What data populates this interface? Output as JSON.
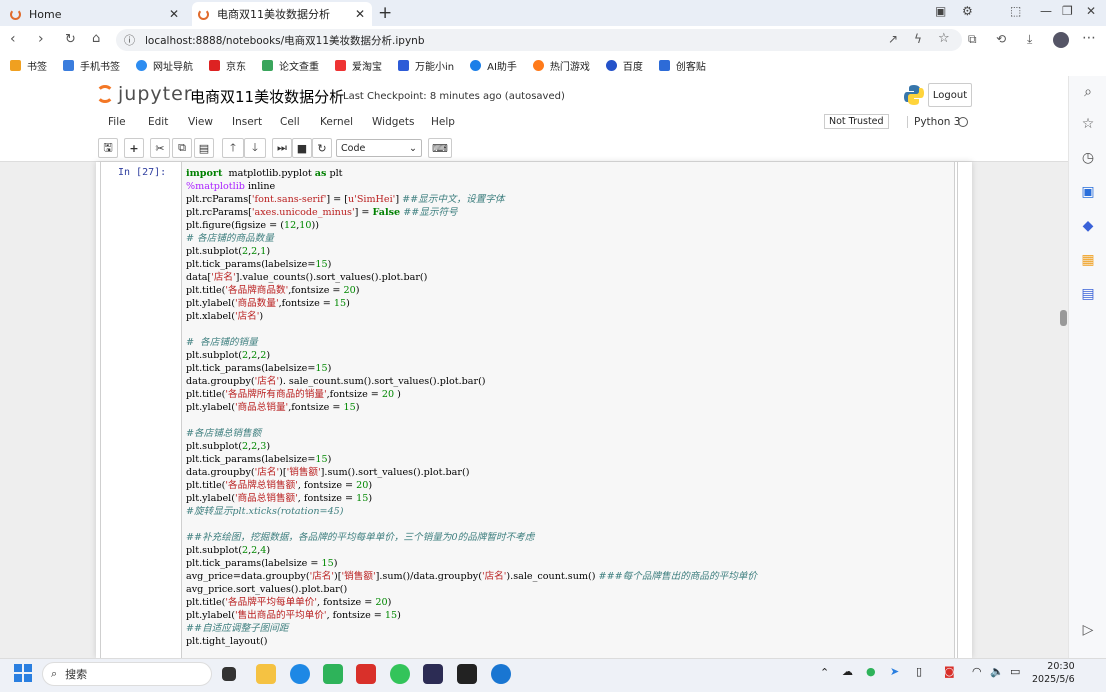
{
  "browser": {
    "tabs": [
      {
        "label": "Home"
      },
      {
        "label": "电商双11美妆数据分析"
      }
    ],
    "url": "localhost:8888/notebooks/电商双11美妆数据分析.ipynb",
    "bookmarks": [
      "书签",
      "手机书签",
      "网址导航",
      "京东",
      "论文查重",
      "爱淘宝",
      "万能小in",
      "AI助手",
      "热门游戏",
      "百度",
      "创客贴"
    ],
    "bookmark_colors": [
      "#f0a020",
      "#3b7ddd",
      "#2d8cf0",
      "#d22",
      "#3aa55c",
      "#e33",
      "#2d5bd7",
      "#1b7fe8",
      "#ff7a1a",
      "#2452c9",
      "#2d6bd7"
    ]
  },
  "jupyter": {
    "logo_text": "jupyter",
    "notebook_title": "电商双11美妆数据分析",
    "checkpoint": "Last Checkpoint: 8 minutes ago (autosaved)",
    "logout": "Logout",
    "menu": [
      "File",
      "Edit",
      "View",
      "Insert",
      "Cell",
      "Kernel",
      "Widgets",
      "Help"
    ],
    "trust": "Not Trusted",
    "kernel": "Python 3",
    "cell_type": "Code",
    "prompt": "In  [27]:"
  },
  "taskbar": {
    "search": "搜索",
    "time": "20:30",
    "date": "2025/5/6"
  },
  "code_lines": [
    [
      [
        "kw",
        "import"
      ],
      [
        "",
        "  matplotlib.pyplot "
      ],
      [
        "kw",
        "as"
      ],
      [
        "",
        " plt"
      ]
    ],
    [
      [
        "mg",
        "%matplotlib"
      ],
      [
        "",
        " inline"
      ]
    ],
    [
      [
        "",
        "plt.rcParams["
      ],
      [
        "str",
        "'font.sans-serif'"
      ],
      [
        "",
        "] = ["
      ],
      [
        "str",
        "u'SimHei'"
      ],
      [
        "",
        "] "
      ],
      [
        "cm",
        "##显示中文，设置字体"
      ]
    ],
    [
      [
        "",
        "plt.rcParams["
      ],
      [
        "str",
        "'axes.unicode_minus'"
      ],
      [
        "",
        "] = "
      ],
      [
        "kw",
        "False"
      ],
      [
        "",
        " "
      ],
      [
        "cm",
        "##显示符号"
      ]
    ],
    [
      [
        "",
        "plt.figure(figsize = ("
      ],
      [
        "num",
        "12"
      ],
      [
        "",
        ","
      ],
      [
        "num",
        "10"
      ],
      [
        "",
        "))"
      ]
    ],
    [
      [
        "cm",
        "# 各店铺的商品数量"
      ]
    ],
    [
      [
        "",
        "plt.subplot("
      ],
      [
        "num",
        "2"
      ],
      [
        "",
        ","
      ],
      [
        "num",
        "2"
      ],
      [
        "",
        ","
      ],
      [
        "num",
        "1"
      ],
      [
        "",
        ")"
      ]
    ],
    [
      [
        "",
        "plt.tick_params(labelsize="
      ],
      [
        "num",
        "15"
      ],
      [
        "",
        ")"
      ]
    ],
    [
      [
        "",
        "data["
      ],
      [
        "str",
        "'店名'"
      ],
      [
        "",
        "].value_counts().sort_values().plot.bar()"
      ]
    ],
    [
      [
        "",
        "plt.title("
      ],
      [
        "str",
        "'各品牌商品数'"
      ],
      [
        "",
        ",fontsize = "
      ],
      [
        "num",
        "20"
      ],
      [
        "",
        ")"
      ]
    ],
    [
      [
        "",
        "plt.ylabel("
      ],
      [
        "str",
        "'商品数量'"
      ],
      [
        "",
        ",fontsize = "
      ],
      [
        "num",
        "15"
      ],
      [
        "",
        ")"
      ]
    ],
    [
      [
        "",
        "plt.xlabel("
      ],
      [
        "str",
        "'店名'"
      ],
      [
        "",
        ")"
      ]
    ],
    [
      [
        "",
        ""
      ]
    ],
    [
      [
        "cm",
        "#  各店铺的销量"
      ]
    ],
    [
      [
        "",
        "plt.subplot("
      ],
      [
        "num",
        "2"
      ],
      [
        "",
        ","
      ],
      [
        "num",
        "2"
      ],
      [
        "",
        ","
      ],
      [
        "num",
        "2"
      ],
      [
        "",
        ")"
      ]
    ],
    [
      [
        "",
        "plt.tick_params(labelsize="
      ],
      [
        "num",
        "15"
      ],
      [
        "",
        ")"
      ]
    ],
    [
      [
        "",
        "data.groupby("
      ],
      [
        "str",
        "'店名'"
      ],
      [
        "",
        "). sale_count.sum().sort_values().plot.bar()"
      ]
    ],
    [
      [
        "",
        "plt.title("
      ],
      [
        "str",
        "'各品牌所有商品的销量'"
      ],
      [
        "",
        ",fontsize = "
      ],
      [
        "num",
        "20"
      ],
      [
        "",
        " )"
      ]
    ],
    [
      [
        "",
        "plt.ylabel("
      ],
      [
        "str",
        "'商品总销量'"
      ],
      [
        "",
        ",fontsize = "
      ],
      [
        "num",
        "15"
      ],
      [
        "",
        ")"
      ]
    ],
    [
      [
        "",
        ""
      ]
    ],
    [
      [
        "cm",
        "#各店铺总销售额"
      ]
    ],
    [
      [
        "",
        "plt.subplot("
      ],
      [
        "num",
        "2"
      ],
      [
        "",
        ","
      ],
      [
        "num",
        "2"
      ],
      [
        "",
        ","
      ],
      [
        "num",
        "3"
      ],
      [
        "",
        ")"
      ]
    ],
    [
      [
        "",
        "plt.tick_params(labelsize="
      ],
      [
        "num",
        "15"
      ],
      [
        "",
        ")"
      ]
    ],
    [
      [
        "",
        "data.groupby("
      ],
      [
        "str",
        "'店名'"
      ],
      [
        "",
        ")["
      ],
      [
        "str",
        "'销售额'"
      ],
      [
        "",
        "].sum().sort_values().plot.bar()"
      ]
    ],
    [
      [
        "",
        "plt.title("
      ],
      [
        "str",
        "'各品牌总销售额'"
      ],
      [
        "",
        ", fontsize = "
      ],
      [
        "num",
        "20"
      ],
      [
        "",
        ")"
      ]
    ],
    [
      [
        "",
        "plt.ylabel("
      ],
      [
        "str",
        "'商品总销售额'"
      ],
      [
        "",
        ", fontsize = "
      ],
      [
        "num",
        "15"
      ],
      [
        "",
        ")"
      ]
    ],
    [
      [
        "cm",
        "#旋转显示plt.xticks(rotation=45)"
      ]
    ],
    [
      [
        "",
        ""
      ]
    ],
    [
      [
        "cm",
        "##补充绘图，挖掘数据，各品牌的平均每单单价，三个销量为0的品牌暂时不考虑"
      ]
    ],
    [
      [
        "",
        "plt.subplot("
      ],
      [
        "num",
        "2"
      ],
      [
        "",
        ","
      ],
      [
        "num",
        "2"
      ],
      [
        "",
        ","
      ],
      [
        "num",
        "4"
      ],
      [
        "",
        ")"
      ]
    ],
    [
      [
        "",
        "plt.tick_params(labelsize = "
      ],
      [
        "num",
        "15"
      ],
      [
        "",
        ")"
      ]
    ],
    [
      [
        "",
        "avg_price=data.groupby("
      ],
      [
        "str",
        "'店名'"
      ],
      [
        "",
        ")["
      ],
      [
        "str",
        "'销售额'"
      ],
      [
        "",
        "].sum()/data.groupby("
      ],
      [
        "str",
        "'店名'"
      ],
      [
        "",
        ").sale_count.sum() "
      ],
      [
        "cm",
        "###每个品牌售出的商品的平均单价"
      ]
    ],
    [
      [
        "",
        "avg_price.sort_values().plot.bar()"
      ]
    ],
    [
      [
        "",
        "plt.title("
      ],
      [
        "str",
        "'各品牌平均每单单价'"
      ],
      [
        "",
        ", fontsize = "
      ],
      [
        "num",
        "20"
      ],
      [
        "",
        ")"
      ]
    ],
    [
      [
        "",
        "plt.ylabel("
      ],
      [
        "str",
        "'售出商品的平均单价'"
      ],
      [
        "",
        ", fontsize = "
      ],
      [
        "num",
        "15"
      ],
      [
        "",
        ")"
      ]
    ],
    [
      [
        "cm",
        "##自适应调整子图间距"
      ]
    ],
    [
      [
        "",
        "plt.tight_layout()"
      ]
    ]
  ]
}
